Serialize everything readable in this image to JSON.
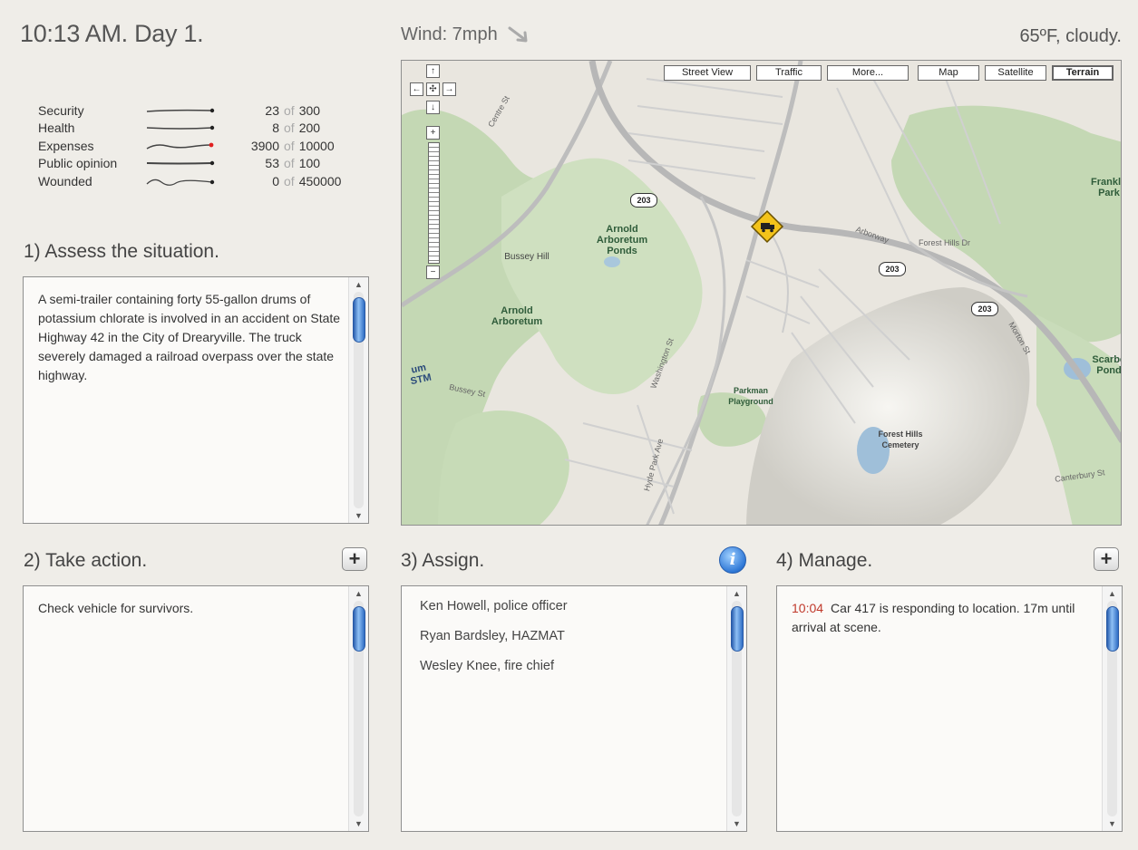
{
  "header": {
    "clock": "10:13 AM. Day 1.",
    "wind": "Wind: 7mph",
    "wind_icon": "arrow-down-right-icon",
    "weather": "65ºF, cloudy."
  },
  "stats": [
    {
      "name": "Security",
      "value": "23",
      "of": "of",
      "max": "300",
      "marker_color": "#222222"
    },
    {
      "name": "Health",
      "value": "8",
      "of": "of",
      "max": "200",
      "marker_color": "#222222"
    },
    {
      "name": "Expenses",
      "value": "3900",
      "of": "of",
      "max": "10000",
      "marker_color": "#e02020"
    },
    {
      "name": "Public opinion",
      "value": "53",
      "of": "of",
      "max": "100",
      "marker_color": "#222222"
    },
    {
      "name": "Wounded",
      "value": "0",
      "of": "of",
      "max": "450000",
      "marker_color": "#222222"
    }
  ],
  "assess": {
    "title": "1) Assess the situation.",
    "text": "A semi-trailer containing forty 55-gallon drums of potassium chlorate is involved in an accident on State Highway 42 in the City of Dreary­ville. The truck severely damaged a railroad overpass over the state highway."
  },
  "action": {
    "title": "2) Take action.",
    "add_label": "+",
    "items": [
      "Check vehicle for survivors."
    ]
  },
  "assign": {
    "title": "3) Assign.",
    "info_label": "i",
    "items": [
      "Ken Howell, police officer",
      "Ryan Bardsley, HAZMAT",
      "Wesley Knee, fire chief"
    ]
  },
  "manage": {
    "title": "4) Manage.",
    "add_label": "+",
    "log": [
      {
        "time": "10:04",
        "text": "Car 417 is responding to location. 17m until arrival at scene."
      }
    ]
  },
  "map": {
    "buttons": [
      "Street View",
      "Traffic",
      "More...",
      "Map",
      "Satellite",
      "Terrain"
    ],
    "active_button": "Terrain",
    "pan": {
      "up": "↑",
      "left": "←",
      "center": "✣",
      "right": "→",
      "down": "↓"
    },
    "zoom_in": "+",
    "zoom_out": "−",
    "labels": {
      "arnold_ponds": "Arnold Arboretum Ponds",
      "arnold": "Arnold Arboretum",
      "bussey_hill": "Bussey Hill",
      "parkman": "Parkman Playground",
      "forest_hills": "Forest Hills Cemetery",
      "franklin": "Franklin Park",
      "scarboro": "Scarbo Pond",
      "stm": "um STM",
      "washington": "Washington St",
      "morton": "Morton St",
      "centre": "Centre St",
      "hyde_park": "Hyde Park Ave",
      "forest_hills_dr": "Forest Hills Dr",
      "arborway": "Arborway",
      "canterbury": "Canterbury St",
      "bussey_st": "Bussey St"
    },
    "shields": [
      "203",
      "203",
      "203"
    ],
    "incident_icon": "truck-warning-icon"
  }
}
